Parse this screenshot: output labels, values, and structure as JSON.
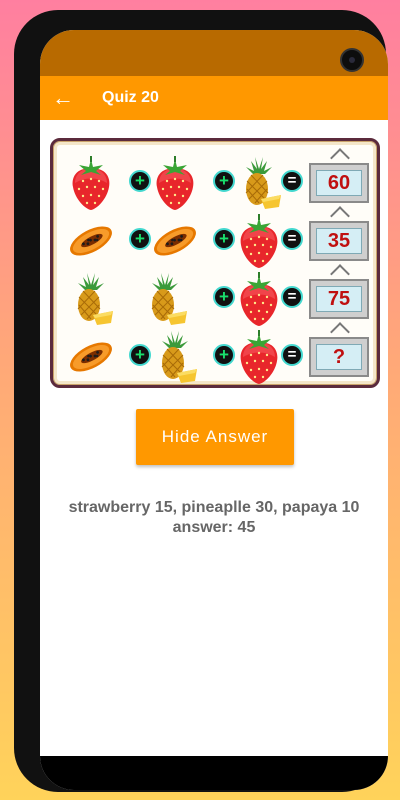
{
  "appbar": {
    "title": "Quiz 20",
    "back_icon": "arrow-left-icon"
  },
  "puzzle": {
    "rows": [
      {
        "items": [
          "strawberry",
          "plus",
          "strawberry",
          "plus",
          "pineapple"
        ],
        "result": "60"
      },
      {
        "items": [
          "papaya",
          "plus",
          "papaya",
          "plus",
          "strawberry"
        ],
        "result": "35"
      },
      {
        "items": [
          "pineapple",
          "pineapple",
          "plus",
          "strawberry"
        ],
        "result": "75"
      },
      {
        "items": [
          "papaya",
          "plus",
          "pineapple",
          "plus",
          "strawberry"
        ],
        "result": "?"
      }
    ],
    "equals_symbol": "=",
    "plus_symbol": "+"
  },
  "button": {
    "label": "Hide Answer"
  },
  "answer": {
    "line1": "strawberry 15, pineaplle 30, papaya 10",
    "line2": "answer: 45"
  },
  "colors": {
    "accent": "#ff9800",
    "status_bar": "#b86a00",
    "result_text": "#c01010"
  }
}
